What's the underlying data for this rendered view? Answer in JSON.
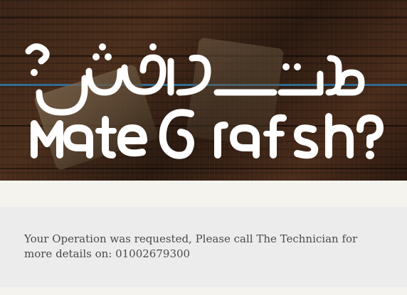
{
  "header": {
    "logo_latin": "MateCrafsh?",
    "logo_arabic": "ماتعرفش؟",
    "logo_icon": "question-mark-icon"
  },
  "message": {
    "text": "Your Operation was requested, Please call The Technician for more details on: 01002679300"
  },
  "colors": {
    "page_background": "#f5f3ee",
    "message_background": "#ececec",
    "message_text": "#4a4a4a",
    "logo": "#ffffff",
    "accent_stripe": "#2f78a6"
  }
}
